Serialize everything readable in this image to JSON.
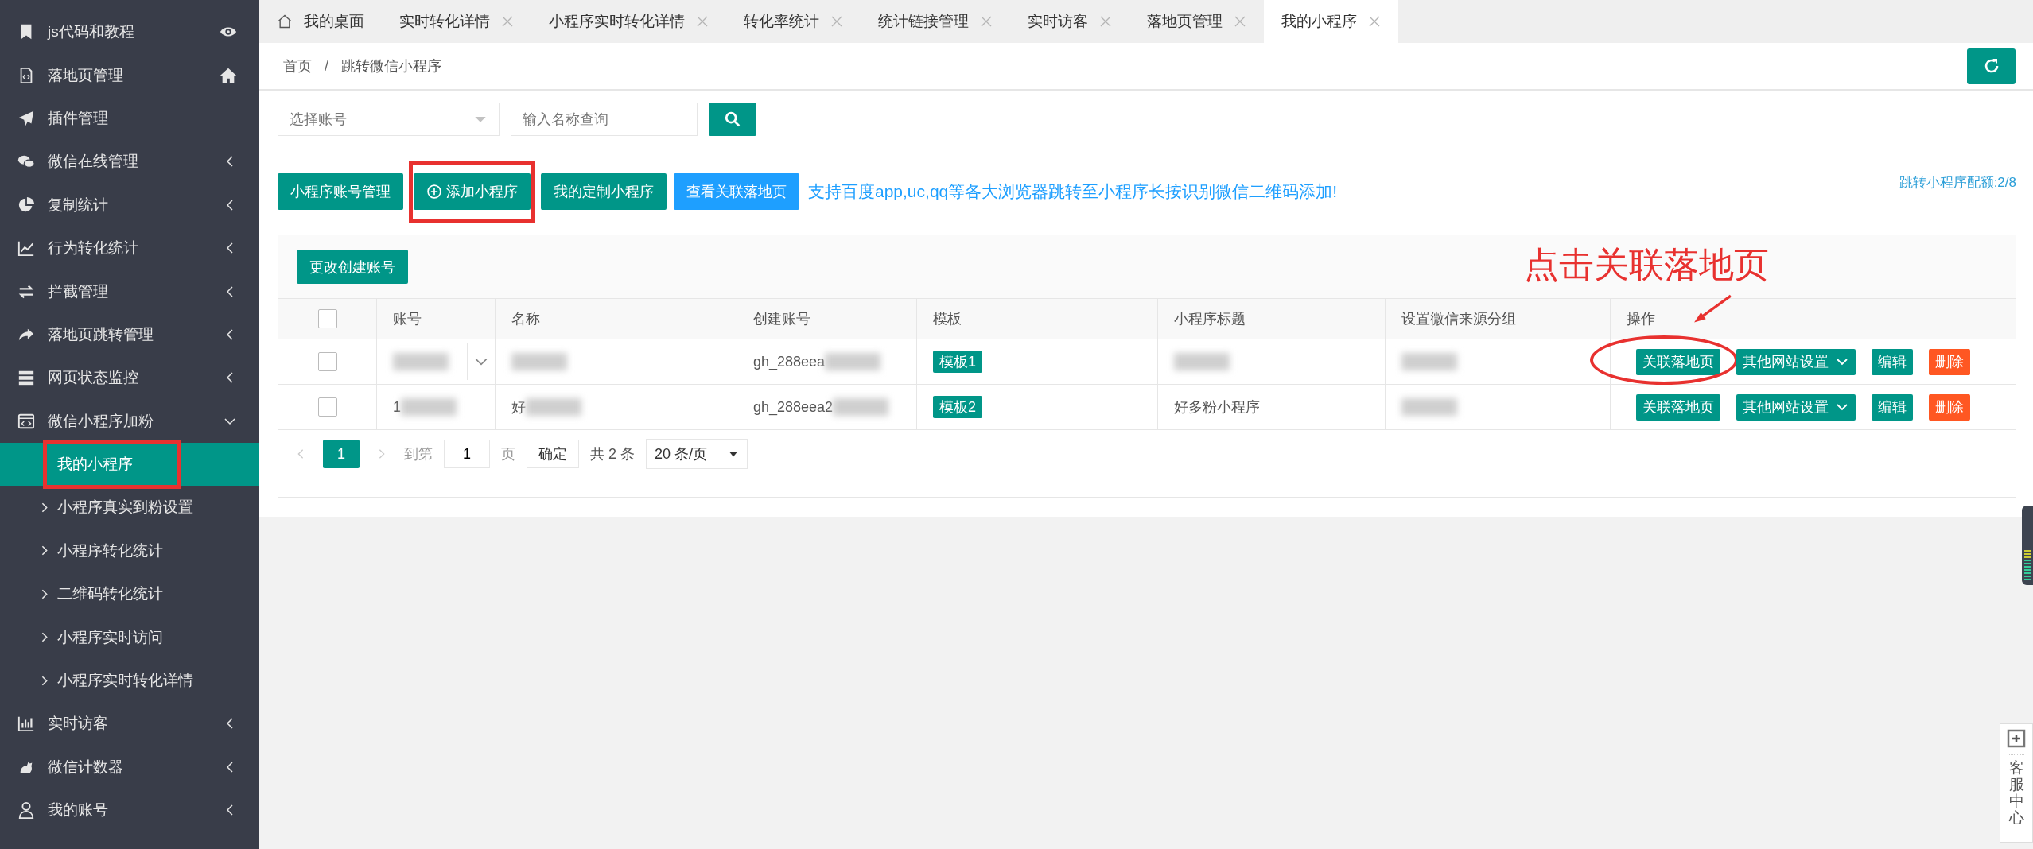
{
  "sidebar": {
    "items": [
      {
        "label": "js代码和教程",
        "kind": "link"
      },
      {
        "label": "落地页管理",
        "kind": "link"
      },
      {
        "label": "插件管理",
        "kind": "link"
      },
      {
        "label": "微信在线管理",
        "kind": "menu",
        "expanded": false
      },
      {
        "label": "复制统计",
        "kind": "menu",
        "expanded": false
      },
      {
        "label": "行为转化统计",
        "kind": "menu",
        "expanded": false
      },
      {
        "label": "拦截管理",
        "kind": "menu",
        "expanded": false
      },
      {
        "label": "落地页跳转管理",
        "kind": "menu",
        "expanded": false
      },
      {
        "label": "网页状态监控",
        "kind": "menu",
        "expanded": false
      },
      {
        "label": "微信小程序加粉",
        "kind": "menu",
        "expanded": true,
        "children": [
          {
            "label": "我的小程序",
            "selected": true,
            "highlighted": true
          },
          {
            "label": "小程序真实到粉设置",
            "selected": false,
            "highlighted": false
          },
          {
            "label": "小程序转化统计",
            "selected": false,
            "highlighted": false
          },
          {
            "label": "二维码转化统计",
            "selected": false,
            "highlighted": false
          },
          {
            "label": "小程序实时访问",
            "selected": false,
            "highlighted": false
          },
          {
            "label": "小程序实时转化详情",
            "selected": false,
            "highlighted": false
          }
        ]
      },
      {
        "label": "实时访客",
        "kind": "menu",
        "expanded": false
      },
      {
        "label": "微信计数器",
        "kind": "menu",
        "expanded": false
      },
      {
        "label": "我的账号",
        "kind": "menu",
        "expanded": false
      }
    ]
  },
  "tabs": [
    {
      "label": "我的桌面",
      "kind": "home",
      "selected": false
    },
    {
      "label": "实时转化详情",
      "kind": "page",
      "selected": false
    },
    {
      "label": "小程序实时转化详情",
      "kind": "page",
      "selected": false
    },
    {
      "label": "转化率统计",
      "kind": "page",
      "selected": false
    },
    {
      "label": "统计链接管理",
      "kind": "page",
      "selected": false
    },
    {
      "label": "实时访客",
      "kind": "page",
      "selected": false
    },
    {
      "label": "落地页管理",
      "kind": "page",
      "selected": false
    },
    {
      "label": "我的小程序",
      "kind": "page",
      "selected": true
    }
  ],
  "breadcrumb": {
    "items": [
      "首页",
      "跳转微信小程序"
    ],
    "separator": "/"
  },
  "search": {
    "account_select": {
      "placeholder": "选择账号"
    },
    "name_field": {
      "placeholder": "输入名称查询"
    }
  },
  "buttons": [
    {
      "label": "小程序账号管理",
      "kind": "primary",
      "highlighted": false
    },
    {
      "label": "添加小程序",
      "kind": "add",
      "highlighted": true
    },
    {
      "label": "我的定制小程序",
      "kind": "primary",
      "highlighted": false
    },
    {
      "label": "查看关联落地页",
      "kind": "info",
      "highlighted": false
    }
  ],
  "notice": "支持百度app,uc,qq等各大浏览器跳转至小程序长按识别微信二维码添加!",
  "quota": "跳转小程序配额:2/8",
  "table": {
    "toolbar_button": "更改创建账号",
    "annotation": "点击关联落地页",
    "header_checked": false,
    "columns": [
      "账号",
      "名称",
      "创建账号",
      "模板",
      "小程序标题",
      "设置微信来源分组",
      "操作"
    ],
    "rows": [
      {
        "checked": false,
        "account": {
          "blurred": true,
          "expandable": true
        },
        "name": {
          "blurred": true
        },
        "created": {
          "text": "gh_288eea",
          "blurred": true
        },
        "template": "模板1",
        "title": {
          "blurred": true
        },
        "group": {
          "blurred": true
        },
        "actions": [
          {
            "label": "关联落地页",
            "kind": "primary",
            "circled": true
          },
          {
            "label": "其他网站设置",
            "kind": "dropdown",
            "circled": false
          },
          {
            "label": "编辑",
            "kind": "primary",
            "circled": false
          },
          {
            "label": "删除",
            "kind": "danger",
            "circled": false
          }
        ]
      },
      {
        "checked": false,
        "account": {
          "text": "1",
          "blurred": true,
          "expandable": false
        },
        "name": {
          "text": "好",
          "blurred": true
        },
        "created": {
          "text": "gh_288eea2",
          "blurred": true
        },
        "template": "模板2",
        "title": {
          "text": "好多粉小程序",
          "blurred": false
        },
        "group": {
          "blurred": true
        },
        "actions": [
          {
            "label": "关联落地页",
            "kind": "primary",
            "circled": false
          },
          {
            "label": "其他网站设置",
            "kind": "dropdown",
            "circled": false
          },
          {
            "label": "编辑",
            "kind": "primary",
            "circled": false
          },
          {
            "label": "删除",
            "kind": "danger",
            "circled": false
          }
        ]
      }
    ]
  },
  "pagination": {
    "pages": [
      {
        "label": "1",
        "selected": true
      }
    ],
    "goto_label": "到第",
    "goto_value": "1",
    "page_unit": "页",
    "confirm": "确定",
    "total": "共 2 条",
    "page_size": "20 条/页"
  },
  "service": {
    "label": "客服中心"
  }
}
